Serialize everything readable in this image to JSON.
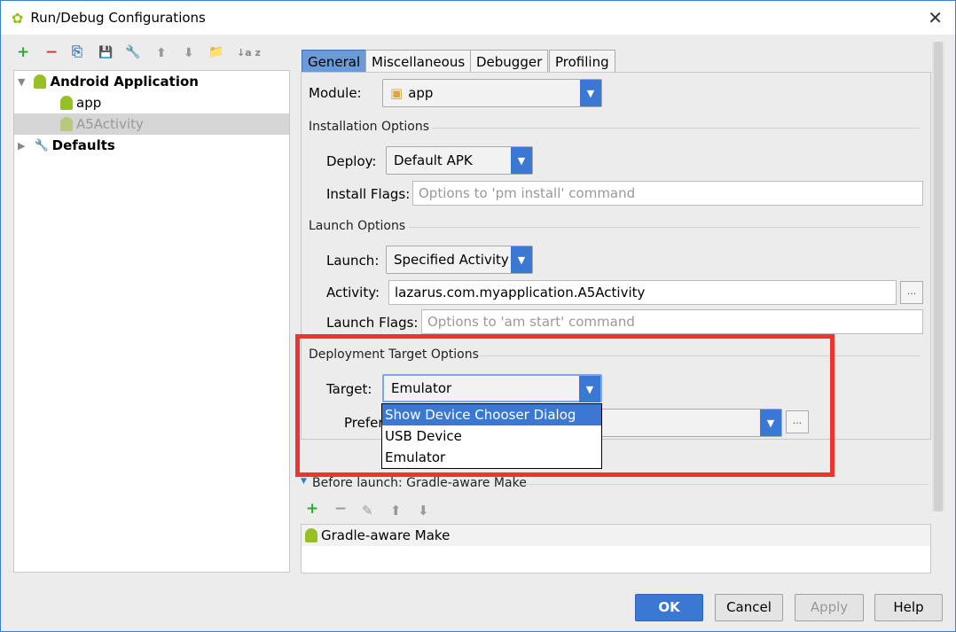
{
  "window": {
    "title": "Run/Debug Configurations",
    "close": "✕"
  },
  "toolbar": {
    "add": "+",
    "remove": "−",
    "copy": "⎘",
    "save": "💾",
    "edit_defaults": "🔧",
    "up": "⬆",
    "down": "⬇",
    "folder": "📁",
    "sort": "↓a z"
  },
  "tree": {
    "items": [
      {
        "label": "Android Application",
        "expanded": true
      },
      {
        "label": "app"
      },
      {
        "label": "A5Activity",
        "selected": true
      },
      {
        "label": "Defaults",
        "expanded": false
      }
    ]
  },
  "tabs": [
    {
      "label": "General",
      "selected": true
    },
    {
      "label": "Miscellaneous"
    },
    {
      "label": "Debugger"
    },
    {
      "label": "Profiling"
    }
  ],
  "general": {
    "module_label": "Module:",
    "module_value": "app",
    "installation_section": "Installation Options",
    "deploy_label": "Deploy:",
    "deploy_value": "Default APK",
    "install_flags_label": "Install Flags:",
    "install_flags_placeholder": "Options to 'pm install' command",
    "launch_section": "Launch Options",
    "launch_label": "Launch:",
    "launch_value": "Specified Activity",
    "activity_label": "Activity:",
    "activity_value": "lazarus.com.myapplication.A5Activity",
    "launch_flags_label": "Launch Flags:",
    "launch_flags_placeholder": "Options to 'am start' command",
    "deployment_section": "Deployment Target Options",
    "target_label": "Target:",
    "target_value": "Emulator",
    "prefer_label": "Prefer",
    "target_options": [
      "Show Device Chooser Dialog",
      "USB Device",
      "Emulator"
    ],
    "ellipsis": "..."
  },
  "before_launch": {
    "title": "Before launch: Gradle-aware Make",
    "items": [
      "Gradle-aware Make"
    ]
  },
  "buttons": {
    "ok": "OK",
    "cancel": "Cancel",
    "apply": "Apply",
    "help": "Help"
  },
  "colors": {
    "accent": "#3b78d4",
    "highlight_box": "#ee3333",
    "android_green": "#97c024"
  }
}
